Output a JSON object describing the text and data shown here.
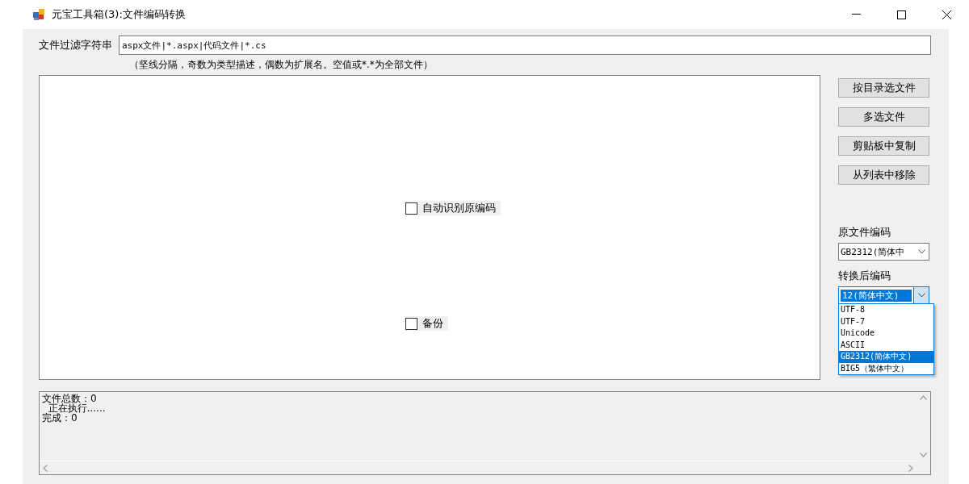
{
  "window": {
    "title": "元宝工具箱(3):文件编码转换"
  },
  "filter": {
    "label": "文件过滤字符串",
    "value": "aspx文件|*.aspx|代码文件|*.cs",
    "hint": "（坚线分隔，奇数为类型描述，偶数为扩展名。空值或*.*为全部文件）"
  },
  "checkboxes": [
    {
      "label": "自动识别原编码",
      "checked": false
    },
    {
      "label": "备份",
      "checked": false
    }
  ],
  "buttons": [
    "按目录选文件",
    "多选文件",
    "剪贴板中复制",
    "从列表中移除"
  ],
  "source_encoding": {
    "label": "原文件编码",
    "value": "GB2312(简体中"
  },
  "target_encoding": {
    "label": "转换后编码",
    "value": "12(简体中文)",
    "expanded": true,
    "options": [
      {
        "label": "UTF-8",
        "selected": false
      },
      {
        "label": "UTF-7",
        "selected": false
      },
      {
        "label": "Unicode",
        "selected": false
      },
      {
        "label": "ASCII",
        "selected": false
      },
      {
        "label": "GB2312(简体中文)",
        "selected": true
      },
      {
        "label": "BIG5（繁体中文）",
        "selected": false
      }
    ]
  },
  "log": {
    "lines": [
      "文件总数：0",
      "  正在执行......",
      "完成：0"
    ]
  }
}
